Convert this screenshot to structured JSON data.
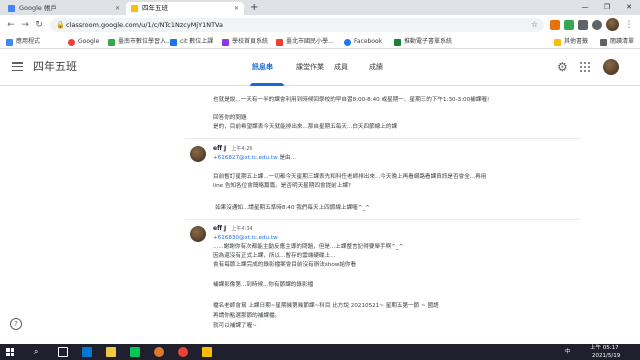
{
  "browser": {
    "tabs": [
      {
        "title": "Google 帳戶",
        "active": false
      },
      {
        "title": "四年五班",
        "active": true
      }
    ],
    "url": "classroom.google.com/u/1/c/NTc1NzcyMjY1NTVa",
    "bookmarks": [
      "應用程式",
      "Google",
      "臺南市數位學習入...",
      "cit 數位上課",
      "學校首頁系統",
      "臺北市國民小學...",
      "Facebook",
      "推動電子書單系統"
    ],
    "bookmarks_right": [
      "其他書籤",
      "閱讀清單"
    ]
  },
  "classroom": {
    "class_name": "四年五班",
    "nav_tabs": [
      "訊息串",
      "課堂作業",
      "成員",
      "成績"
    ],
    "selected_tab": "訊息串"
  },
  "stream": {
    "top_lines": [
      "也就是說...一天有一半的課會利用到時候回學校的早自習8:00-8:40 或星期一、星期三的下午1:30-3:00補課喔!",
      "回答你的問題",
      "是的，目前希望課表今天就能排出來...那自星期五每天...白天四節線上的課"
    ],
    "comment1": {
      "author": "eff J",
      "time": "上午4:26",
      "mention": "+616827@st.tc.edu.tw",
      "mention_suffix": "是由...",
      "lines": [
        "目前暫訂星期五上課...一切都今天星期三課表先和科任老師排出來...今天晚上再看網路看課資訊是否會全...再用",
        "line 告知各位會簡略篇篇。是否明天星期四會提前上課?",
        "如果沒通知...請星期五準時8:40 我們每天上四節線上課喔^_^"
      ]
    },
    "comment2": {
      "author": "eff J",
      "time": "上午4:34",
      "mention": "+616830@st.tc.edu.tw",
      "lines": [
        "......謝謝你有次都能主動反應主導的問題，但是...上課整言記得要舉手啊^_^",
        "因為還沒有正式上課，所以...暫存的雲端硬碟上...",
        "會有每節上課完成的錄影檔案會目前沒有辦法show給你看",
        "補課影像第...到時候...你有節課的錄影檔",
        "檔名老師會寫 上課日期~星期幾第幾節課~科目    比方說    20210521~ 星期五第一節 ~ 國語",
        "再請你點選那節的補課檔。",
        "就可以補課了喔~"
      ]
    }
  },
  "taskbar": {
    "time": "上午 05:17",
    "date": "2021/5/19",
    "lang": "中"
  },
  "colors": {
    "accent": "#1967d2",
    "link": "#1a73e8",
    "taskbar": "#1f1f2e"
  }
}
